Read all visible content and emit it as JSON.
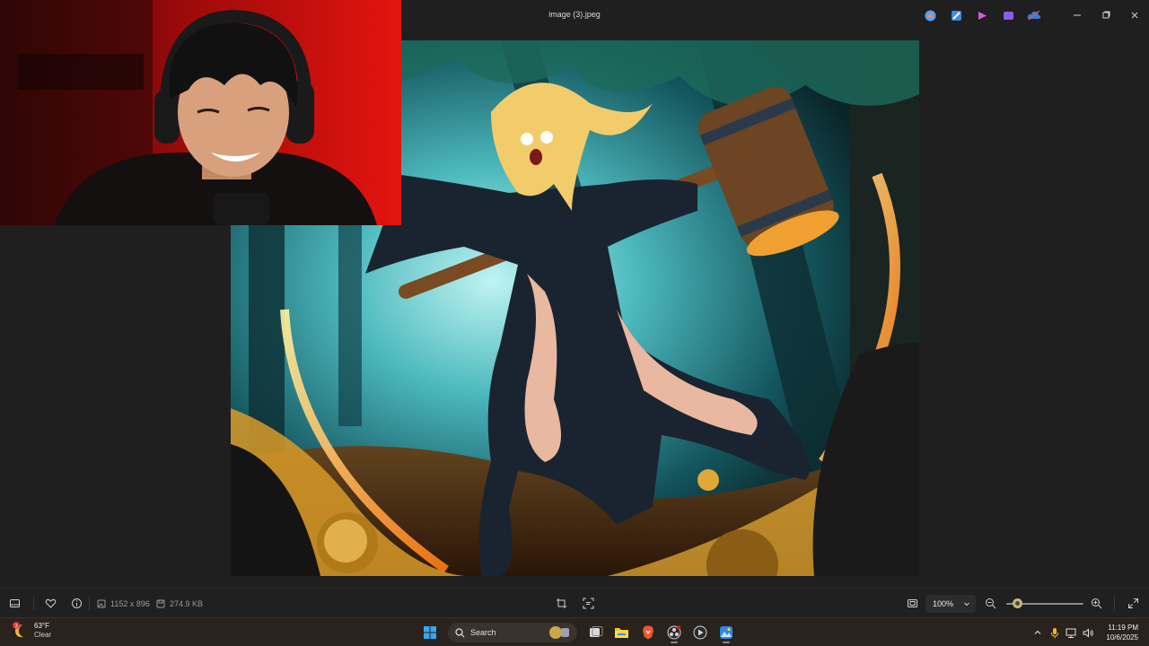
{
  "window": {
    "title": "image (3).jpeg",
    "controls": {
      "minimize": "minimize",
      "maximize": "maximize",
      "close": "close"
    },
    "edit_tools": [
      "copilot-icon",
      "paint-icon",
      "clipchamp-icon",
      "designer-icon",
      "onedrive-icon"
    ]
  },
  "image_info": {
    "dimensions": "1152 x 896",
    "file_size": "274.9 KB"
  },
  "zoom": {
    "value": "100%",
    "slider_fraction": 0.15
  },
  "weather": {
    "badge": "3",
    "temperature": "63°F",
    "condition": "Clear"
  },
  "taskbar": {
    "search_placeholder": "Search",
    "apps": [
      "start",
      "search",
      "task-view",
      "file-explorer",
      "brave",
      "obs",
      "media-player",
      "photos"
    ]
  },
  "clock": {
    "time": "11:19 PM",
    "date": "10/6/2025"
  },
  "colors": {
    "window_bg": "#1f1f1f",
    "taskbar_bg": "#2a221c",
    "accent": "#c8b77a"
  }
}
